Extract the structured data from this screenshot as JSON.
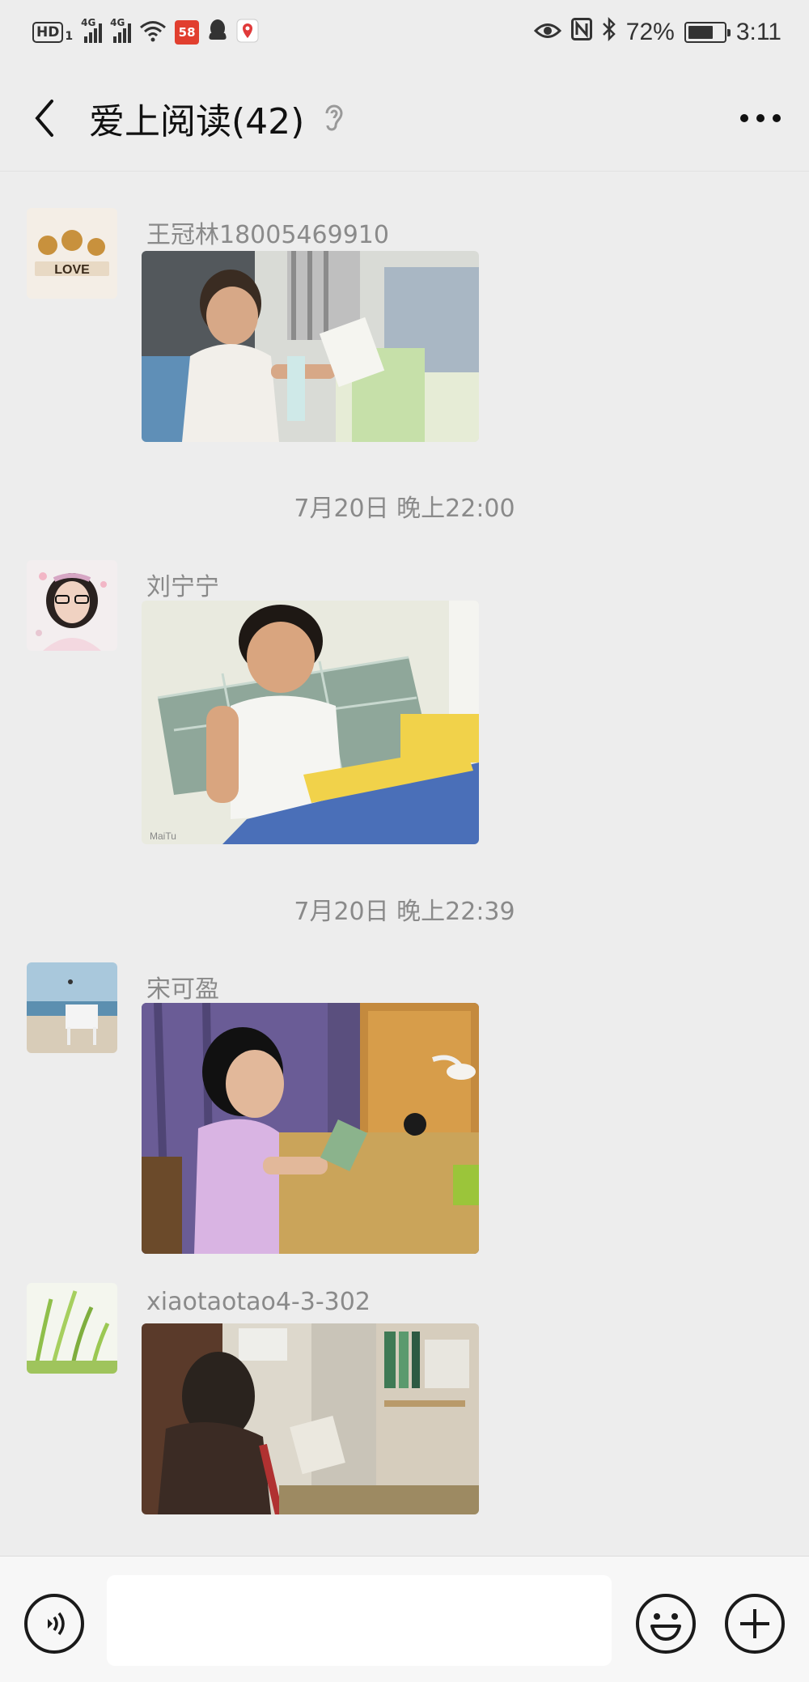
{
  "status_bar": {
    "hd": "HD",
    "sim_index": "1",
    "signal1_tag": "4G",
    "signal2_tag": "4G",
    "app_badge": "58",
    "battery": "72%",
    "battery_level": 0.72,
    "time": "3:11"
  },
  "header": {
    "title": "爱上阅读(42)"
  },
  "messages": [
    {
      "sender": "王冠林18005469910",
      "photo_icon": "photo-boy-reading-at-desk"
    },
    {
      "sender": "刘宁宁",
      "photo_icon": "photo-boy-reading-on-bed"
    },
    {
      "sender": "宋可盈",
      "photo_icon": "photo-girl-reading-at-desk"
    },
    {
      "sender": "xiaotaotao4-3-302",
      "photo_icon": "photo-girl-reading-by-bookshelf"
    }
  ],
  "timestamps": [
    "7月20日 晚上22:00",
    "7月20日 晚上22:39"
  ],
  "input_bar": {
    "placeholder": ""
  },
  "colors": {
    "background": "#ededed",
    "input_bar_bg": "#f7f7f7",
    "secondary_text": "#8a8a8a"
  }
}
